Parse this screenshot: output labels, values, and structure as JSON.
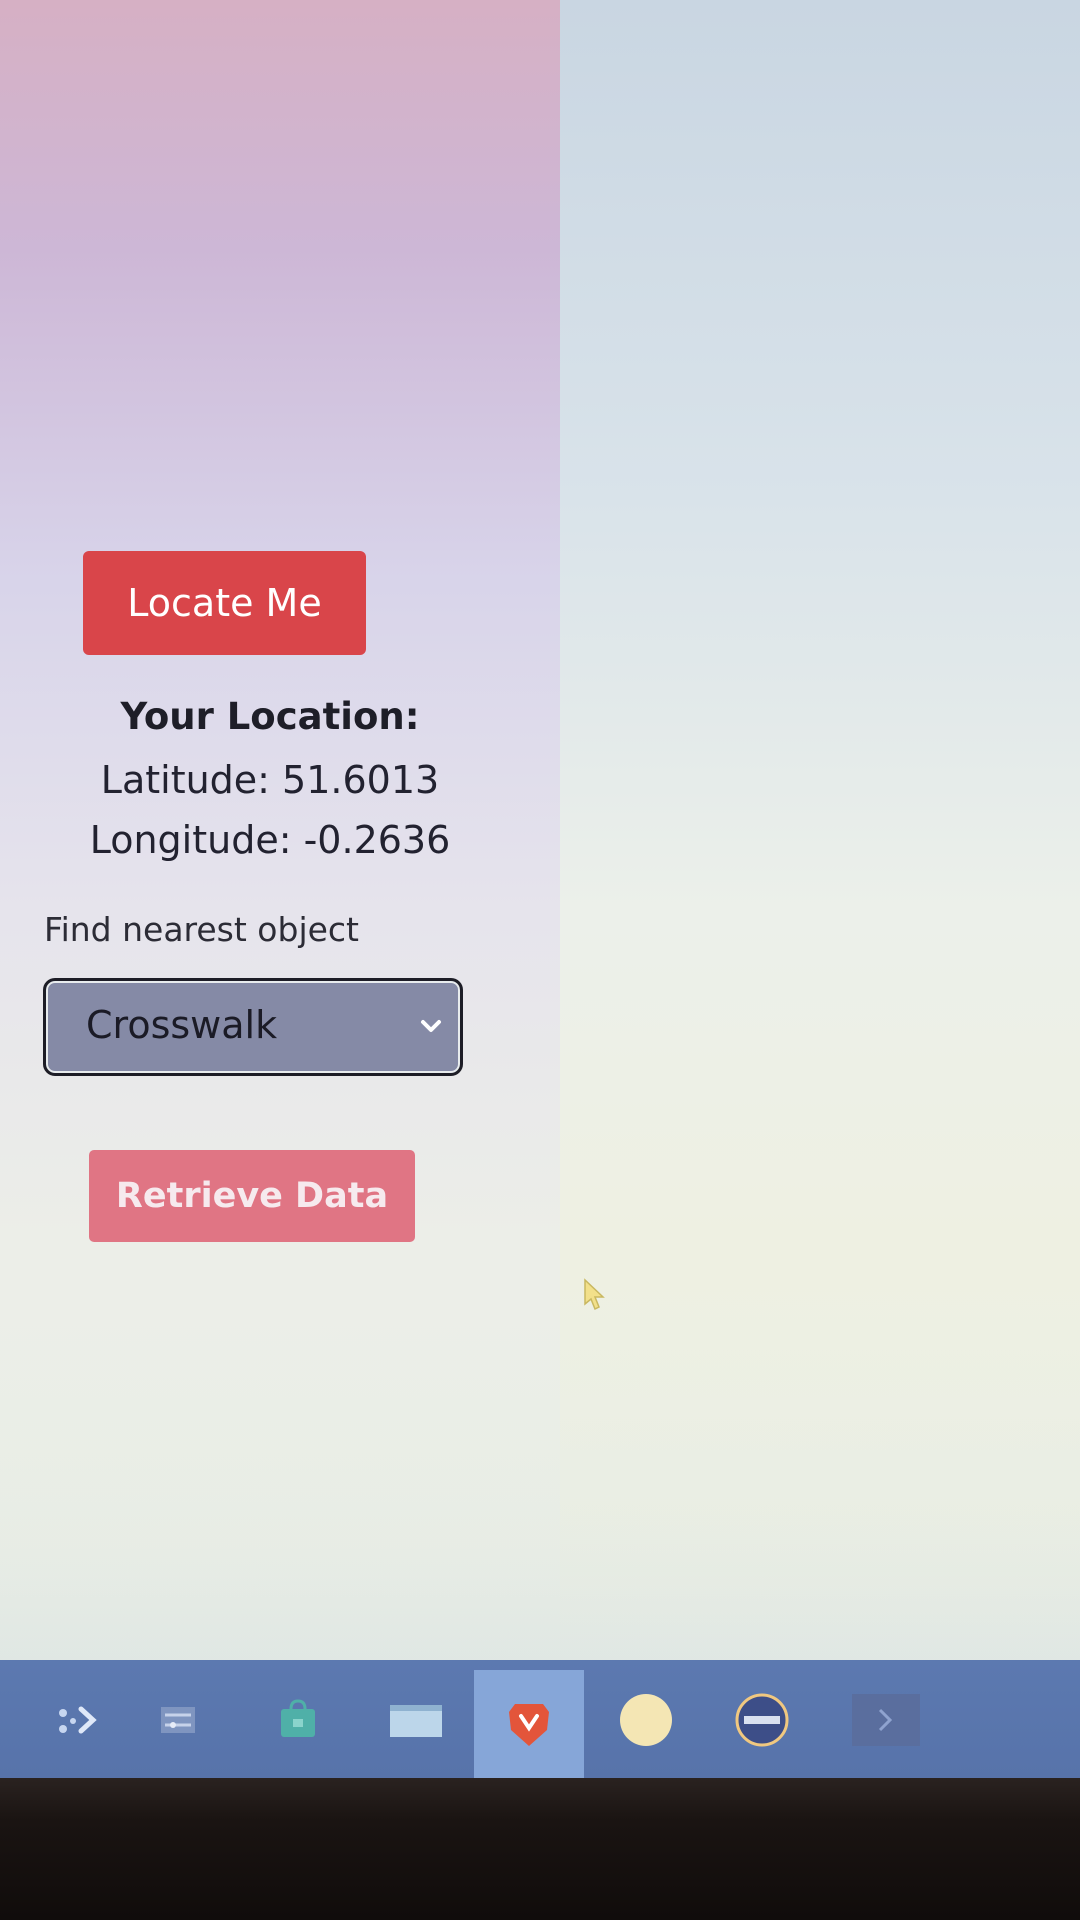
{
  "locate_button": {
    "label": "Locate Me"
  },
  "location": {
    "title": "Your Location:",
    "latitude_text": "Latitude: 51.6013",
    "longitude_text": "Longitude: -0.2636"
  },
  "find_nearest": {
    "label": "Find nearest object",
    "selected": "Crosswalk"
  },
  "retrieve_button": {
    "label": "Retrieve Data"
  },
  "colors": {
    "locate_button": "#d9454a",
    "retrieve_button": "#e07584",
    "select_background": "#858aa6",
    "taskbar": "#5c79b0"
  },
  "taskbar": {
    "items": [
      {
        "icon": "app-launcher-icon"
      },
      {
        "icon": "settings-sliders-icon"
      },
      {
        "icon": "store-bag-icon"
      },
      {
        "icon": "files-folder-icon"
      },
      {
        "icon": "brave-browser-icon",
        "active": true
      },
      {
        "icon": "circle-app-icon"
      },
      {
        "icon": "media-player-icon"
      },
      {
        "icon": "terminal-icon"
      }
    ]
  }
}
